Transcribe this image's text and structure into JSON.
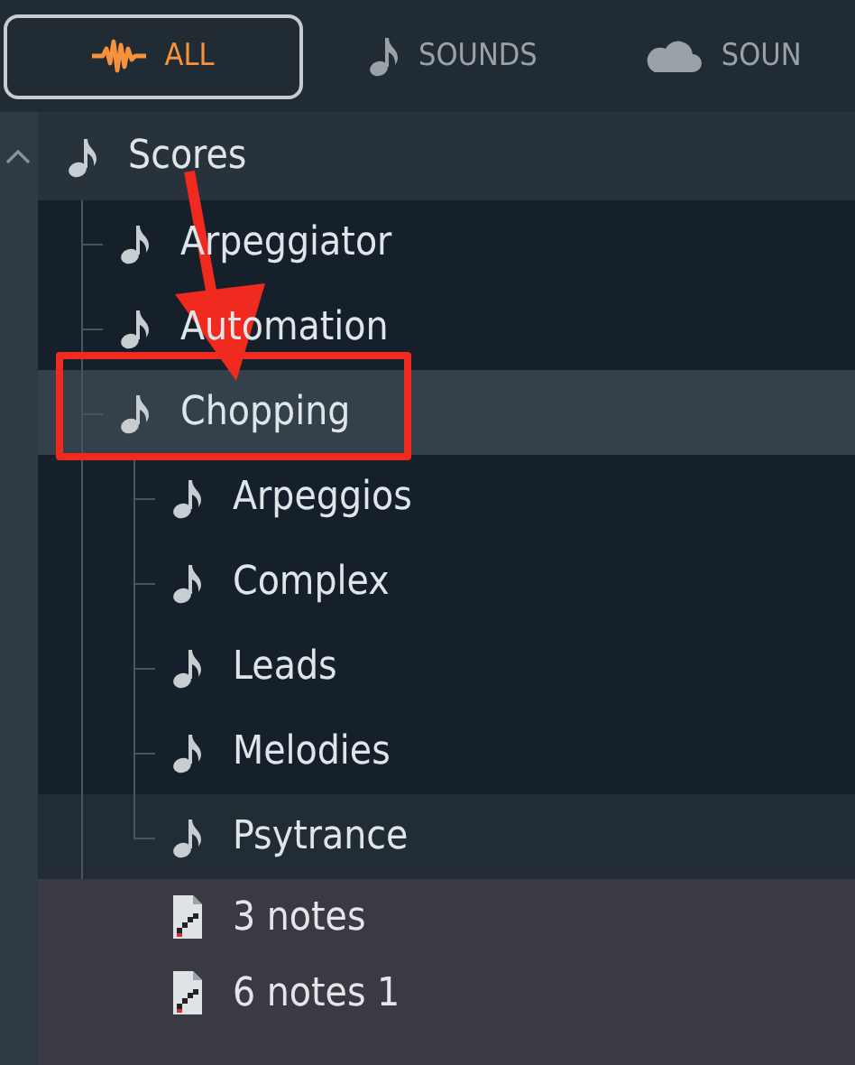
{
  "tabs": [
    {
      "label": "ALL",
      "kind": "all",
      "selected": true
    },
    {
      "label": "SOUNDS",
      "kind": "sounds",
      "selected": false
    },
    {
      "label": "SOUN",
      "kind": "cloud",
      "selected": false
    }
  ],
  "tree": {
    "expanded": true,
    "items": [
      {
        "label": "Scores",
        "kind": "folder",
        "selected": false,
        "children": [
          {
            "label": "Arpeggiator",
            "kind": "folder",
            "selected": false
          },
          {
            "label": "Automation",
            "kind": "folder",
            "selected": false
          },
          {
            "label": "Chopping",
            "kind": "folder",
            "selected": true,
            "callout": true,
            "children": [
              {
                "label": "Arpeggios",
                "kind": "folder",
                "selected": false
              },
              {
                "label": "Complex",
                "kind": "folder",
                "selected": false
              },
              {
                "label": "Leads",
                "kind": "folder",
                "selected": false
              },
              {
                "label": "Melodies",
                "kind": "folder",
                "selected": false
              },
              {
                "label": "Psytrance",
                "kind": "folder",
                "selected": false,
                "hovered": true
              },
              {
                "label": "3 notes",
                "kind": "file",
                "selected": false
              },
              {
                "label": "6 notes 1",
                "kind": "file",
                "selected": false
              }
            ]
          }
        ]
      }
    ]
  }
}
